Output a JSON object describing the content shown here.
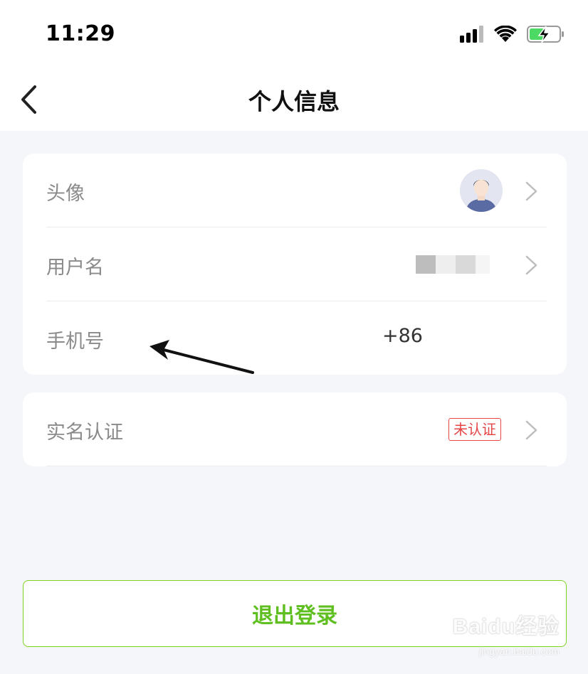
{
  "status_bar": {
    "time": "11:29",
    "icons": [
      "signal-icon",
      "wifi-icon",
      "battery-charging-icon"
    ],
    "battery_color": "#4cd964"
  },
  "nav": {
    "title": "个人信息",
    "back_icon": "chevron-left-icon"
  },
  "profile_rows": [
    {
      "label": "头像",
      "value_type": "avatar"
    },
    {
      "label": "用户名",
      "value_type": "obscured"
    },
    {
      "label": "手机号",
      "value": "+86"
    }
  ],
  "verification_row": {
    "label": "实名认证",
    "status": "未认证",
    "status_color": "#e64545"
  },
  "logout": {
    "label": "退出登录",
    "accent_color": "#5fbf20"
  },
  "watermark": {
    "brand": "Baidu经验",
    "url": "jingyan.baidu.com"
  }
}
